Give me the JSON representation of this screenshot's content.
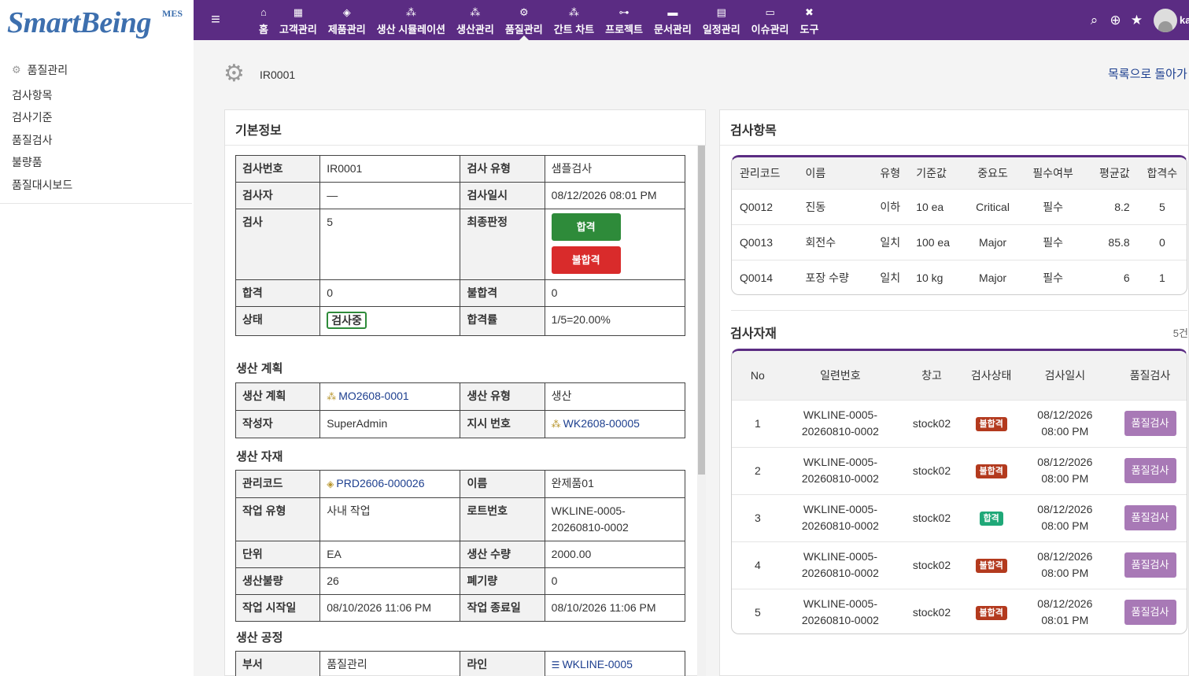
{
  "brand": {
    "name": "SmartBeing",
    "suffix": "MES"
  },
  "nav": [
    {
      "label": "홈",
      "icon": "home-icon",
      "glyph": "⌂",
      "active": false
    },
    {
      "label": "고객관리",
      "icon": "building-icon",
      "glyph": "▦",
      "active": false
    },
    {
      "label": "제품관리",
      "icon": "cube-icon",
      "glyph": "◈",
      "active": false
    },
    {
      "label": "생산 시뮬레이션",
      "icon": "cubes-icon",
      "glyph": "⁂",
      "active": false
    },
    {
      "label": "생산관리",
      "icon": "cubes-icon",
      "glyph": "⁂",
      "active": false
    },
    {
      "label": "품질관리",
      "icon": "cogs-icon",
      "glyph": "⚙",
      "active": true
    },
    {
      "label": "간트 차트",
      "icon": "cubes-icon",
      "glyph": "⁂",
      "active": false
    },
    {
      "label": "프로젝트",
      "icon": "sitemap-icon",
      "glyph": "⊶",
      "active": false
    },
    {
      "label": "문서관리",
      "icon": "folder-icon",
      "glyph": "▬",
      "active": false
    },
    {
      "label": "일정관리",
      "icon": "calendar-icon",
      "glyph": "▤",
      "active": false
    },
    {
      "label": "이슈관리",
      "icon": "money-icon",
      "glyph": "▭",
      "active": false
    },
    {
      "label": "도구",
      "icon": "tools-icon",
      "glyph": "✖",
      "active": false
    }
  ],
  "topright": {
    "user": "ka"
  },
  "sidebar": {
    "heading": "품질관리",
    "items": [
      "검사항목",
      "검사기준",
      "품질검사",
      "불량품",
      "품질대시보드"
    ]
  },
  "header": {
    "id": "IR0001",
    "back": "목록으로 돌아가"
  },
  "basic": {
    "title": "기본정보",
    "rows": {
      "inspection_no_label": "검사번호",
      "inspection_no": "IR0001",
      "type_label": "검사 유형",
      "type": "샘플검사",
      "inspector_label": "검사자",
      "inspector": "—",
      "datetime_label": "검사일시",
      "datetime": "08/12/2026 08:01 PM",
      "count_label": "검사",
      "count": "5",
      "verdict_label": "최종판정",
      "pass_btn": "합격",
      "fail_btn": "불합격",
      "pass_label": "합격",
      "pass": "0",
      "fail_label": "불합격",
      "fail": "0",
      "status_label": "상태",
      "status": "검사중",
      "rate_label": "합격률",
      "rate": "1/5=20.00%"
    }
  },
  "plan": {
    "title": "생산 계획",
    "plan_label": "생산 계획",
    "plan": "MO2608-0001",
    "ptype_label": "생산 유형",
    "ptype": "생산",
    "author_label": "작성자",
    "author": "SuperAdmin",
    "order_label": "지시 번호",
    "order": "WK2608-00005"
  },
  "material": {
    "title": "생산 자재",
    "code_label": "관리코드",
    "code": "PRD2606-000026",
    "name_label": "이름",
    "name": "완제품01",
    "worktype_label": "작업 유형",
    "worktype": "사내 작업",
    "lot_label": "로트번호",
    "lot1": "WKLINE-0005-",
    "lot2": "20260810-0002",
    "unit_label": "단위",
    "unit": "EA",
    "qty_label": "생산 수량",
    "qty": "2000.00",
    "defect_label": "생산불량",
    "defect": "26",
    "scrap_label": "폐기량",
    "scrap": "0",
    "start_label": "작업 시작일",
    "start": "08/10/2026 11:06 PM",
    "end_label": "작업 종료일",
    "end": "08/10/2026 11:06 PM"
  },
  "process": {
    "title": "생산 공정",
    "dept_label": "부서",
    "dept": "품질관리",
    "line_label": "라인",
    "line": "WKLINE-0005"
  },
  "items": {
    "title": "검사항목",
    "headers": [
      "관리코드",
      "이름",
      "유형",
      "기준값",
      "중요도",
      "필수여부",
      "평균값",
      "합격수"
    ],
    "rows": [
      [
        "Q0012",
        "진동",
        "이하",
        "10 ea",
        "Critical",
        "필수",
        "8.2",
        "5"
      ],
      [
        "Q0013",
        "회전수",
        "일치",
        "100 ea",
        "Major",
        "필수",
        "85.8",
        "0"
      ],
      [
        "Q0014",
        "포장 수량",
        "일치",
        "10 kg",
        "Major",
        "필수",
        "6",
        "1"
      ]
    ]
  },
  "materials_list": {
    "title": "검사자재",
    "count": "5건",
    "headers": [
      "No",
      "일련번호",
      "창고",
      "검사상태",
      "검사일시",
      "품질검사"
    ],
    "rows": [
      {
        "no": "1",
        "serial1": "WKLINE-0005-",
        "serial2": "20260810-0002",
        "wh": "stock02",
        "status": "불합격",
        "pass": false,
        "d1": "08/12/2026",
        "d2": "08:00 PM",
        "btn": "품질검사"
      },
      {
        "no": "2",
        "serial1": "WKLINE-0005-",
        "serial2": "20260810-0002",
        "wh": "stock02",
        "status": "불합격",
        "pass": false,
        "d1": "08/12/2026",
        "d2": "08:00 PM",
        "btn": "품질검사"
      },
      {
        "no": "3",
        "serial1": "WKLINE-0005-",
        "serial2": "20260810-0002",
        "wh": "stock02",
        "status": "합격",
        "pass": true,
        "d1": "08/12/2026",
        "d2": "08:00 PM",
        "btn": "품질검사"
      },
      {
        "no": "4",
        "serial1": "WKLINE-0005-",
        "serial2": "20260810-0002",
        "wh": "stock02",
        "status": "불합격",
        "pass": false,
        "d1": "08/12/2026",
        "d2": "08:00 PM",
        "btn": "품질검사"
      },
      {
        "no": "5",
        "serial1": "WKLINE-0005-",
        "serial2": "20260810-0002",
        "wh": "stock02",
        "status": "불합격",
        "pass": false,
        "d1": "08/12/2026",
        "d2": "08:01 PM",
        "btn": "품질검사"
      }
    ]
  },
  "colors": {
    "nav_bg": "#5b2c83",
    "pass": "#2e8b3a",
    "fail": "#d92b2b",
    "qc_button": "#a879b6"
  }
}
